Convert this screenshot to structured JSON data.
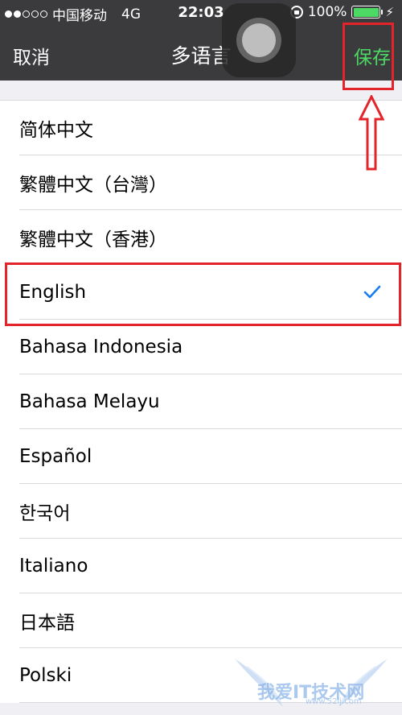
{
  "status_bar": {
    "carrier": "中国移动",
    "network": "4G",
    "time": "22:03",
    "battery_percent": "100%",
    "battery_level": 1.0,
    "signal_filled": 2,
    "signal_total": 5
  },
  "nav": {
    "cancel_label": "取消",
    "title": "多语言",
    "save_label": "保存"
  },
  "languages": [
    {
      "label": "简体中文",
      "selected": false
    },
    {
      "label": "繁體中文（台灣）",
      "selected": false
    },
    {
      "label": "繁體中文（香港）",
      "selected": false
    },
    {
      "label": "English",
      "selected": true
    },
    {
      "label": "Bahasa Indonesia",
      "selected": false
    },
    {
      "label": "Bahasa Melayu",
      "selected": false
    },
    {
      "label": "Español",
      "selected": false
    },
    {
      "label": "한국어",
      "selected": false
    },
    {
      "label": "Italiano",
      "selected": false
    },
    {
      "label": "日本語",
      "selected": false
    },
    {
      "label": "Polski",
      "selected": false
    }
  ],
  "colors": {
    "nav_background": "#3b3b3d",
    "save_green": "#4cd964",
    "checkmark_blue": "#1a7cf5",
    "annotation_red": "#e3242b"
  },
  "icons": {
    "checkmark": "checkmark-icon",
    "battery": "battery-icon",
    "charging": "charging-bolt-icon",
    "rotation_lock": "rotation-lock-icon"
  },
  "watermark": {
    "text": "我爱IT技术网",
    "url": "www.52ij.com"
  }
}
